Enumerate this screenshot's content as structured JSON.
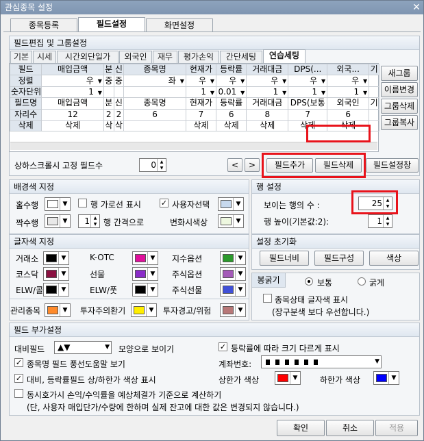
{
  "window": {
    "title": "관심종목 설정",
    "close": "✕"
  },
  "tabs": [
    "종목등록",
    "필드설정",
    "화면설정"
  ],
  "field_panel": {
    "title": "필드편집 및 그룹설정",
    "subtabs": [
      "기본",
      "시세",
      "시간외단일가",
      "외국인",
      "재무",
      "평가손익",
      "간단세팅",
      "연습세팅"
    ],
    "row_headers": [
      "필드",
      "정렬",
      "숫자단위",
      "필드명",
      "자리수",
      "삭제"
    ],
    "columns": [
      {
        "h": "매입금액",
        "align": "우",
        "unit": "1",
        "name": "매입금액",
        "digits": "12",
        "del": "삭제"
      },
      {
        "h": "분",
        "align": "중",
        "unit": "",
        "name": "분",
        "digits": "2",
        "del": "삭"
      },
      {
        "h": "신",
        "align": "중",
        "unit": "",
        "name": "신",
        "digits": "2",
        "del": "삭"
      },
      {
        "h": "종목명",
        "align": "좌",
        "unit": "",
        "name": "종목명",
        "digits": "6",
        "del": ""
      },
      {
        "h": "현재가",
        "align": "우",
        "unit": "1",
        "name": "현재가",
        "digits": "7",
        "del": "삭제"
      },
      {
        "h": "등락률",
        "align": "우",
        "unit": "0.01",
        "name": "등락률",
        "digits": "6",
        "del": "삭제"
      },
      {
        "h": "거래대금",
        "align": "우",
        "unit": "1",
        "name": "거래대금",
        "digits": "8",
        "del": "삭제"
      },
      {
        "h": "DPS(...",
        "align": "우",
        "unit": "1",
        "name": "DPS(보통",
        "digits": "7",
        "del": "삭제"
      },
      {
        "h": "외국...",
        "align": "우",
        "unit": "1",
        "name": "외국인",
        "digits": "6",
        "del": "삭제"
      }
    ],
    "extra_col": "기",
    "side_buttons": [
      "새그룹",
      "이름변경",
      "그룹삭제",
      "그룹복사"
    ],
    "fixed_label": "상하스크롤시 고정 필드수",
    "fixed_value": "0",
    "prev": "<",
    "next": ">",
    "add": "필드추가",
    "delete": "필드삭제",
    "field_window": "필드설정창"
  },
  "bg_panel": {
    "title": "배경색 지정",
    "odd": "홀수행",
    "even": "짝수행",
    "row_line": "행 가로선 표시",
    "gap_value": "1",
    "gap_label": "행 간격으로",
    "user_select": "사용자선택",
    "change_color": "변화시색상"
  },
  "row_panel": {
    "title": "행 설정",
    "visible_label": "보이는 행의 수 :",
    "visible_value": "25",
    "height_label": "행 높이(기본값:2):",
    "height_value": "1"
  },
  "text_panel": {
    "title": "글자색 지정",
    "items": [
      "거래소",
      "K-OTC",
      "지수옵션",
      "코스닥",
      "선물",
      "주식옵션",
      "ELW/콜",
      "ELW/풋",
      "주식선물"
    ],
    "colors": [
      "#000000",
      "#e0109c",
      "#2c9a2c",
      "#8a1040",
      "#8a2cc8",
      "#a45ab8",
      "#000000",
      "#000000",
      "#4050d8"
    ],
    "mgmt": "관리종목",
    "caution": "투자주의환기",
    "warning": "투자경고/위험",
    "mgmt_colors": [
      "#ff8a2a",
      "#ffee00",
      "#b87878"
    ]
  },
  "reset_panel": {
    "title": "설정 초기화",
    "buttons": [
      "필드너비",
      "필드구성",
      "색상"
    ]
  },
  "bold_panel": {
    "title": "봉굵기",
    "normal": "보통",
    "bold": "굵게",
    "status_text": "종목상태 글자색 표시",
    "note": "(장구분색 보다 우선합니다.)"
  },
  "extra_panel": {
    "title": "필드 부가설정",
    "cmp_label": "대비필드",
    "cmp_value": "▲▼",
    "cmp_suffix": "모양으로 보이기",
    "size_by_rate": "등락률에 따라 크기 다르게 표시",
    "balloon": "종목명 필드 풍선도움말 보기",
    "account": "계좌번호:",
    "updown": "대비, 등락률필드 상/하한가 색상 표시",
    "upper": "상한가 색상",
    "lower": "하한가 색상",
    "upper_color": "#ff0000",
    "lower_color": "#0000ff",
    "calc": "동시호가시 손익/수익률을 예상체결가 기준으로 계산하기",
    "calc_note": "(단, 사용자 매입단가/수량에 한하며 실제 잔고에 대한 값은 변경되지 않습니다.)"
  },
  "footer": {
    "ok": "확인",
    "cancel": "취소",
    "apply": "적용"
  }
}
